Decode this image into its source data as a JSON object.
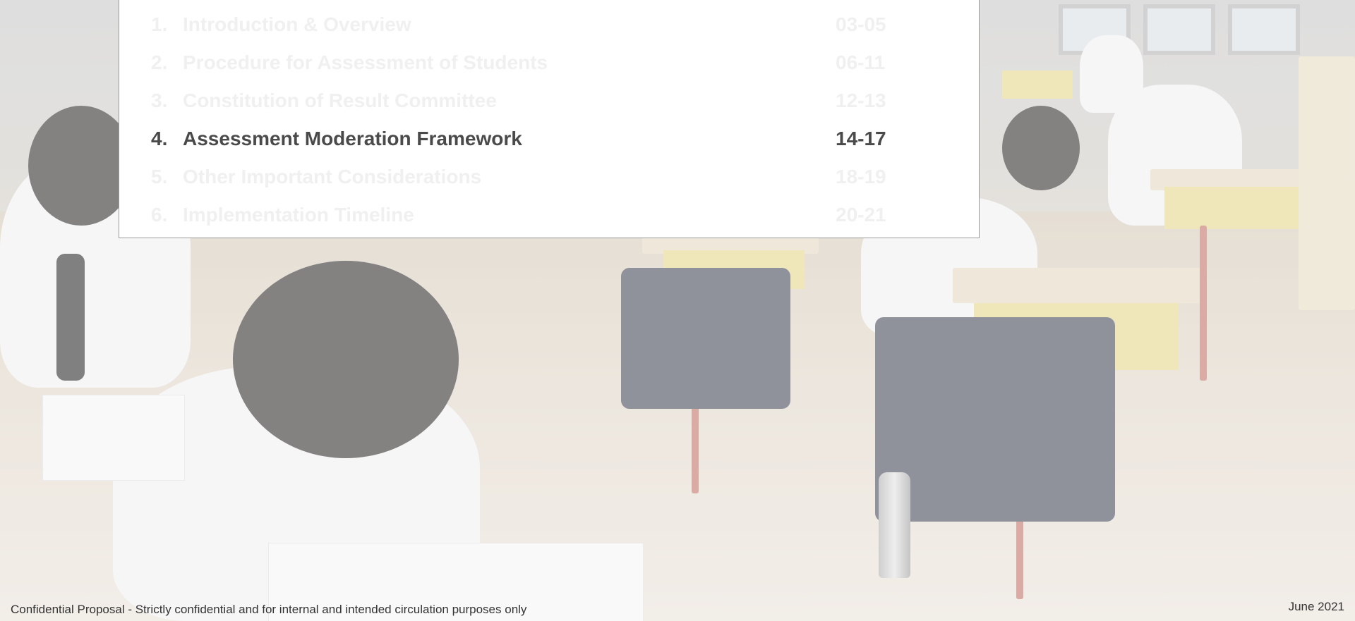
{
  "toc": {
    "items": [
      {
        "num": "1.",
        "title": "Introduction & Overview",
        "pages": "03-05",
        "active": false
      },
      {
        "num": "2.",
        "title": "Procedure for Assessment of Students",
        "pages": "06-11",
        "active": false
      },
      {
        "num": "3.",
        "title": "Constitution of Result Committee",
        "pages": "12-13",
        "active": false
      },
      {
        "num": "4.",
        "title": "Assessment Moderation Framework",
        "pages": "14-17",
        "active": true
      },
      {
        "num": "5.",
        "title": "Other Important Considerations",
        "pages": "18-19",
        "active": false
      },
      {
        "num": "6.",
        "title": "Implementation Timeline",
        "pages": "20-21",
        "active": false
      }
    ]
  },
  "footer": {
    "left": "Confidential Proposal - Strictly confidential and for internal and intended circulation purposes only",
    "right": "June 2021"
  },
  "colors": {
    "active_text": "#4a4a4a",
    "inactive_text": "#f0f0f0"
  }
}
